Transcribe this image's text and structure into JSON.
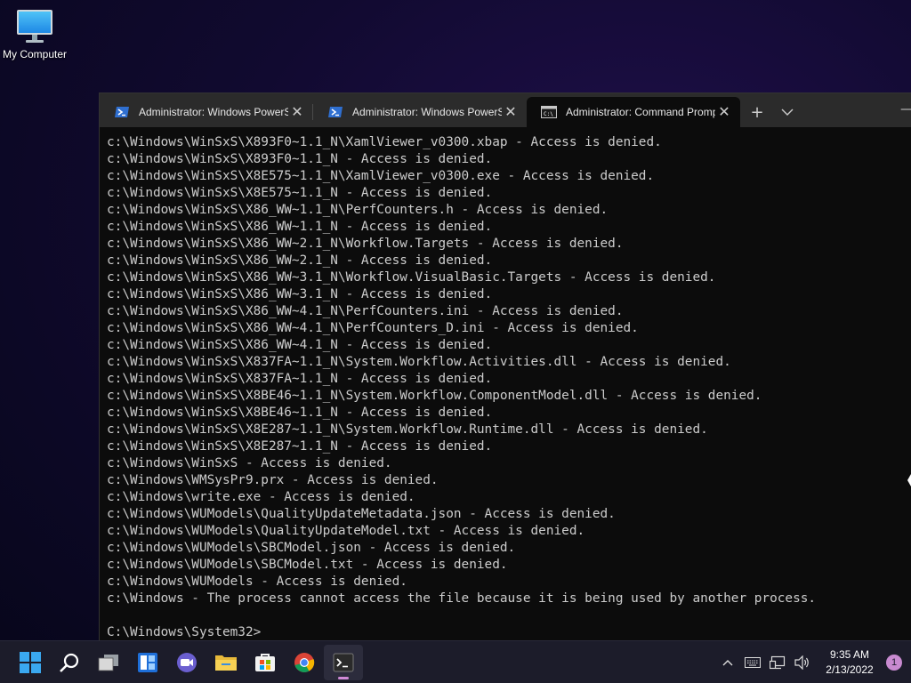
{
  "desktop": {
    "icons": [
      {
        "label": "My Computer",
        "icon": "monitor-icon"
      }
    ]
  },
  "terminal": {
    "tabs": [
      {
        "title": "Administrator: Windows PowerS",
        "icon": "powershell-icon",
        "active": false
      },
      {
        "title": "Administrator: Windows PowerS",
        "icon": "powershell-icon",
        "active": false
      },
      {
        "title": "Administrator: Command Promp",
        "icon": "cmd-icon",
        "active": true
      }
    ],
    "new_tab_label": "+",
    "dropdown_label": "⌄",
    "minimize_label": "—",
    "tab_close_label": "✕",
    "lines": [
      "c:\\Windows\\WinSxS\\X893F0~1.1_N\\XamlViewer_v0300.xbap - Access is denied.",
      "c:\\Windows\\WinSxS\\X893F0~1.1_N - Access is denied.",
      "c:\\Windows\\WinSxS\\X8E575~1.1_N\\XamlViewer_v0300.exe - Access is denied.",
      "c:\\Windows\\WinSxS\\X8E575~1.1_N - Access is denied.",
      "c:\\Windows\\WinSxS\\X86_WW~1.1_N\\PerfCounters.h - Access is denied.",
      "c:\\Windows\\WinSxS\\X86_WW~1.1_N - Access is denied.",
      "c:\\Windows\\WinSxS\\X86_WW~2.1_N\\Workflow.Targets - Access is denied.",
      "c:\\Windows\\WinSxS\\X86_WW~2.1_N - Access is denied.",
      "c:\\Windows\\WinSxS\\X86_WW~3.1_N\\Workflow.VisualBasic.Targets - Access is denied.",
      "c:\\Windows\\WinSxS\\X86_WW~3.1_N - Access is denied.",
      "c:\\Windows\\WinSxS\\X86_WW~4.1_N\\PerfCounters.ini - Access is denied.",
      "c:\\Windows\\WinSxS\\X86_WW~4.1_N\\PerfCounters_D.ini - Access is denied.",
      "c:\\Windows\\WinSxS\\X86_WW~4.1_N - Access is denied.",
      "c:\\Windows\\WinSxS\\X837FA~1.1_N\\System.Workflow.Activities.dll - Access is denied.",
      "c:\\Windows\\WinSxS\\X837FA~1.1_N - Access is denied.",
      "c:\\Windows\\WinSxS\\X8BE46~1.1_N\\System.Workflow.ComponentModel.dll - Access is denied.",
      "c:\\Windows\\WinSxS\\X8BE46~1.1_N - Access is denied.",
      "c:\\Windows\\WinSxS\\X8E287~1.1_N\\System.Workflow.Runtime.dll - Access is denied.",
      "c:\\Windows\\WinSxS\\X8E287~1.1_N - Access is denied.",
      "c:\\Windows\\WinSxS - Access is denied.",
      "c:\\Windows\\WMSysPr9.prx - Access is denied.",
      "c:\\Windows\\write.exe - Access is denied.",
      "c:\\Windows\\WUModels\\QualityUpdateMetadata.json - Access is denied.",
      "c:\\Windows\\WUModels\\QualityUpdateModel.txt - Access is denied.",
      "c:\\Windows\\WUModels\\SBCModel.json - Access is denied.",
      "c:\\Windows\\WUModels\\SBCModel.txt - Access is denied.",
      "c:\\Windows\\WUModels - Access is denied.",
      "c:\\Windows - The process cannot access the file because it is being used by another process.",
      "",
      "C:\\Windows\\System32>"
    ]
  },
  "taskbar": {
    "apps": [
      {
        "name": "start-button",
        "icon": "windows-logo-icon",
        "active": false
      },
      {
        "name": "search-button",
        "icon": "search-icon",
        "active": false
      },
      {
        "name": "task-view-button",
        "icon": "task-view-icon",
        "active": false
      },
      {
        "name": "widgets-button",
        "icon": "widgets-icon",
        "active": false
      },
      {
        "name": "teams-chat-button",
        "icon": "chat-camera-icon",
        "active": false
      },
      {
        "name": "file-explorer-button",
        "icon": "folder-icon",
        "active": false
      },
      {
        "name": "store-button",
        "icon": "store-icon",
        "active": false
      },
      {
        "name": "chrome-button",
        "icon": "chrome-icon",
        "active": false
      },
      {
        "name": "terminal-button",
        "icon": "terminal-icon",
        "active": true
      }
    ],
    "tray": {
      "icons": [
        "chevron-up-icon",
        "keyboard-icon",
        "network-icon",
        "volume-icon"
      ],
      "time": "9:35 AM",
      "date": "2/13/2022",
      "notification_count": "1"
    }
  },
  "colors": {
    "console_text": "#cccccc",
    "console_bg": "#0c0c0c",
    "accent": "#d08ad6"
  }
}
